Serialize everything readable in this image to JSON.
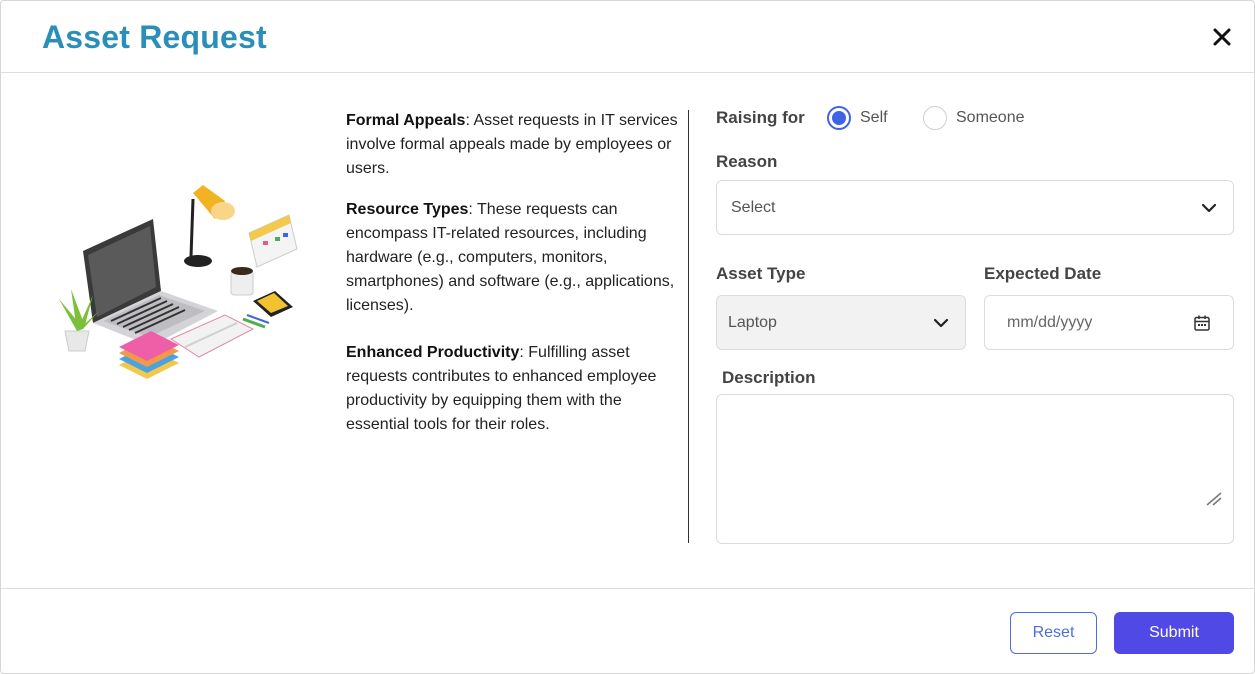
{
  "modal": {
    "title": "Asset Request",
    "close_icon": "close-icon"
  },
  "info": {
    "sections": [
      {
        "heading": "Formal Appeals",
        "text": ": Asset requests in IT services involve formal appeals made by employees or users."
      },
      {
        "heading": "Resource Types",
        "text": ": These requests can encompass IT-related resources, including hardware (e.g., computers, monitors, smartphones) and software (e.g., applications, licenses)."
      },
      {
        "heading": "Enhanced Productivity",
        "text": ": Fulfilling asset requests contributes to enhanced employee productivity by equipping them with the essential tools for their roles."
      }
    ]
  },
  "form": {
    "raising_for": {
      "label": "Raising for",
      "options": [
        "Self",
        "Someone"
      ],
      "selected": "Self"
    },
    "reason": {
      "label": "Reason",
      "value": "Select",
      "icon": "chevron-down-icon"
    },
    "asset_type": {
      "label": "Asset Type",
      "value": "Laptop",
      "icon": "chevron-down-icon"
    },
    "expected_date": {
      "label": "Expected Date",
      "placeholder": "mm/dd/yyyy",
      "icon": "calendar-icon"
    },
    "description": {
      "label": "Description",
      "value": ""
    }
  },
  "actions": {
    "reset_label": "Reset",
    "submit_label": "Submit"
  },
  "colors": {
    "title": "#2a8fb8",
    "accent": "#3e63e6",
    "submit": "#5149e5"
  }
}
